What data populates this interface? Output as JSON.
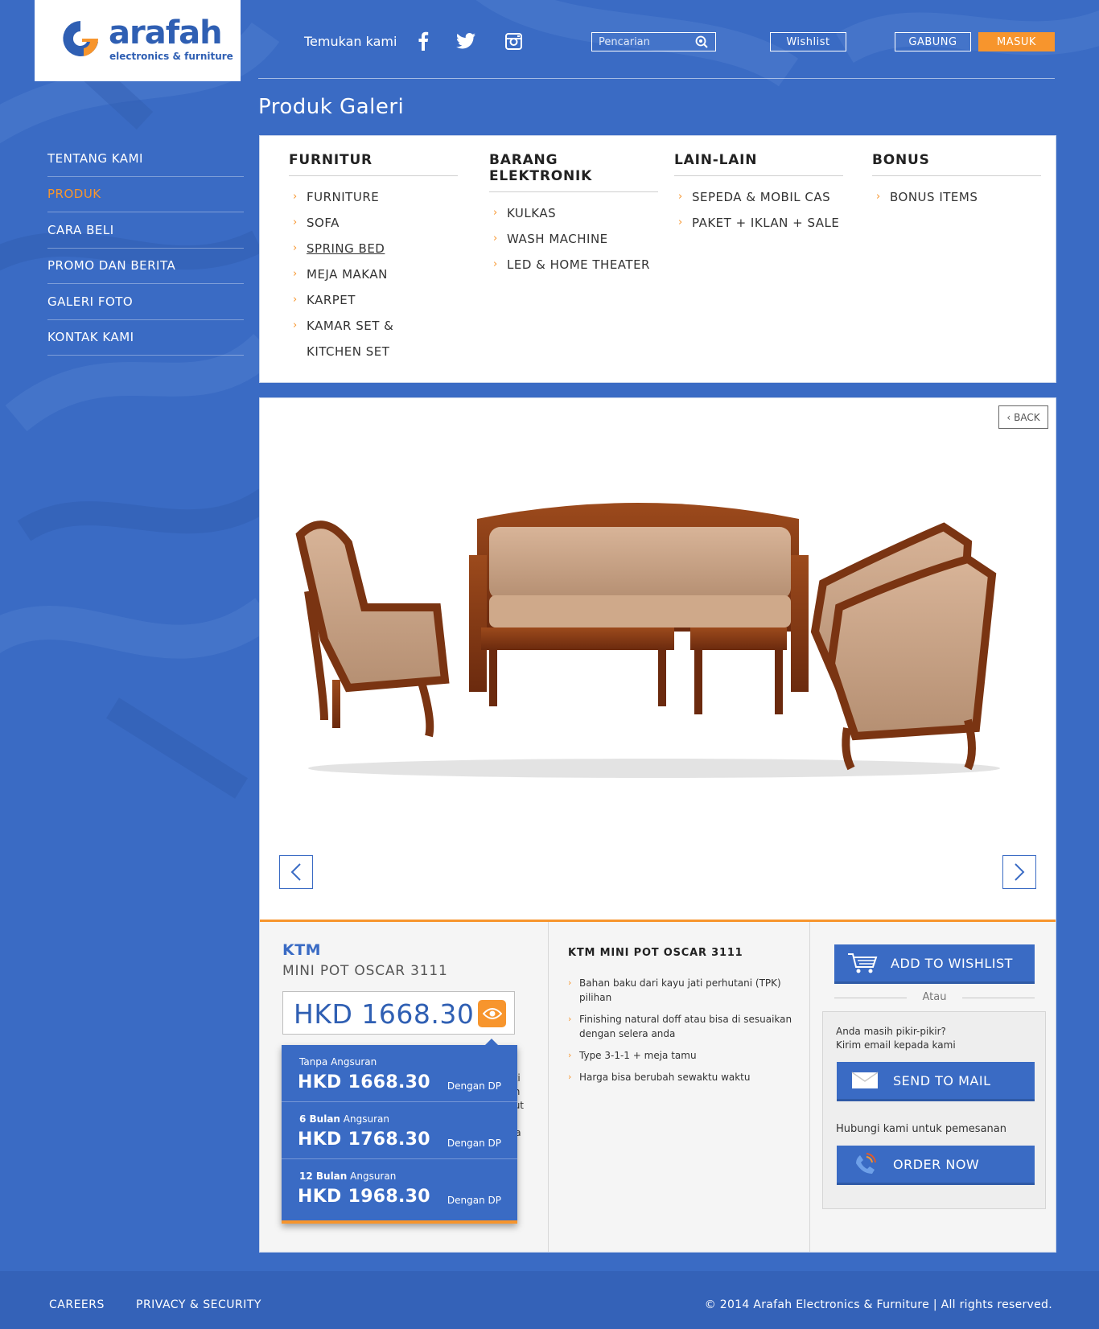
{
  "header": {
    "logo": {
      "name": "arafah",
      "tagline": "electronics & furniture"
    },
    "find_label": "Temukan kami",
    "social": [
      "facebook-icon",
      "twitter-icon",
      "instagram-icon"
    ],
    "search": {
      "placeholder": "Pencarian"
    },
    "wishlist_label": "Wishlist",
    "join_label": "GABUNG",
    "login_label": "MASUK"
  },
  "sidebar": {
    "items": [
      {
        "label": "TENTANG KAMI",
        "active": false
      },
      {
        "label": "PRODUK",
        "active": true
      },
      {
        "label": "CARA BELI",
        "active": false
      },
      {
        "label": "PROMO DAN BERITA",
        "active": false
      },
      {
        "label": "GALERI FOTO",
        "active": false
      },
      {
        "label": "KONTAK KAMI",
        "active": false
      }
    ]
  },
  "page_title": "Produk Galeri",
  "categories": [
    {
      "title": "FURNITUR",
      "items": [
        "FURNITURE",
        "SOFA",
        "SPRING BED",
        "MEJA MAKAN",
        "KARPET",
        "KAMAR SET &",
        "KITCHEN SET"
      ]
    },
    {
      "title": "BARANG ELEKTRONIK",
      "items": [
        "KULKAS",
        "WASH MACHINE",
        "LED & HOME THEATER"
      ]
    },
    {
      "title": "LAIN-LAIN",
      "items": [
        "SEPEDA & MOBIL CAS",
        "PAKET + IKLAN + SALE"
      ]
    },
    {
      "title": "BONUS",
      "items": [
        "BONUS ITEMS"
      ]
    }
  ],
  "product": {
    "back_label": "BACK",
    "brand": "KTM",
    "model": "MINI POT OSCAR 3111",
    "price": "HKD 1668.30",
    "desc_partial": [
      "n",
      "jati",
      "ain",
      "alut",
      "ara"
    ],
    "installments": [
      {
        "bold": "",
        "label": "Tanpa Angsuran",
        "price": "HKD 1668.30",
        "note": "Dengan DP"
      },
      {
        "bold": "6 Bulan",
        "label": " Angsuran",
        "price": "HKD 1768.30",
        "note": "Dengan DP"
      },
      {
        "bold": "12 Bulan",
        "label": " Angsuran",
        "price": "HKD 1968.30",
        "note": "Dengan DP"
      }
    ],
    "desc_title": "KTM MINI POT OSCAR 3111",
    "desc_items": [
      "Bahan baku dari kayu jati perhutani (TPK) pilihan",
      "Finishing natural doff atau bisa di sesuaikan dengan selera anda",
      "Type 3-1-1 + meja tamu",
      "Harga bisa berubah sewaktu waktu"
    ]
  },
  "actions": {
    "wishlist_label": "ADD TO WISHLIST",
    "or_label": "Atau",
    "mail_text_1": "Anda masih pikir-pikir?",
    "mail_text_2": "Kirim email kepada kami",
    "send_mail_label": "SEND TO MAIL",
    "contact_text": "Hubungi kami untuk pemesanan",
    "order_label": "ORDER NOW"
  },
  "footer": {
    "careers": "CAREERS",
    "privacy": "PRIVACY & SECURITY",
    "copyright": "© 2014 Arafah Electronics & Furniture  |  All rights reserved."
  },
  "colors": {
    "background": "#3a6bc4",
    "accent": "#f7952d",
    "panel": "#ffffff"
  }
}
